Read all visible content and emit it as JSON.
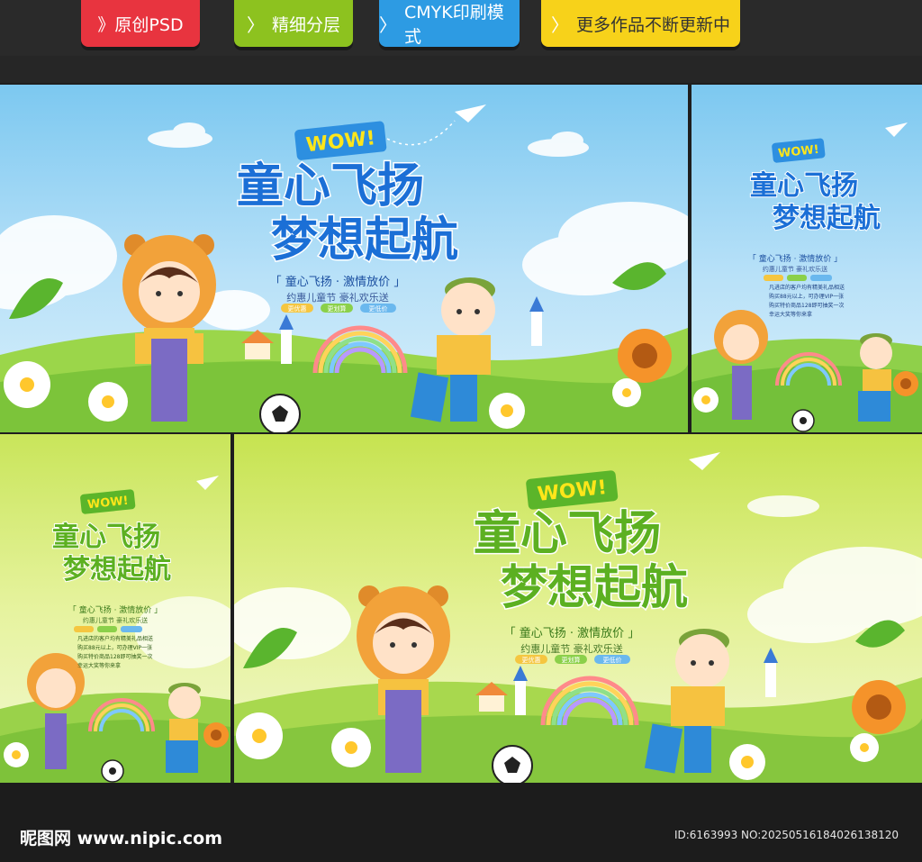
{
  "header": {
    "tags": [
      {
        "label": "》原创PSD",
        "color": "#e8343f"
      },
      {
        "label": "精细分层",
        "color": "#8dc21f"
      },
      {
        "label": "CMYK印刷模式",
        "color": "#2d9be3"
      },
      {
        "label": "更多作品不断更新中",
        "color": "#f7d21a"
      }
    ]
  },
  "poster": {
    "badge": "WOW!",
    "title_line1": "童心飞扬",
    "title_line2": "梦想起航",
    "subtitle": "「 童心飞扬 · 激情放价 」",
    "slogan": "约惠儿童节 豪礼欢乐送",
    "pills": [
      "更优惠",
      "更划算",
      "更低价"
    ],
    "list": [
      "凡进店的客户均有精美礼品相送",
      "购买88元以上，可办理VIP一张",
      "购买特价商品128即可抽奖一次",
      "幸运大奖等你来拿"
    ]
  },
  "colors": {
    "blue_title": "#1b6fd6",
    "green_title": "#5cb021",
    "title_outline": "#ffffff",
    "badge_blue": "#2d8fe0",
    "badge_green": "#5bb52a",
    "badge_text": "#ffe61a"
  },
  "footer": {
    "watermark": "昵图网 www.nipic.com",
    "id_text": "ID:6163993 NO:20250516184026138120"
  }
}
